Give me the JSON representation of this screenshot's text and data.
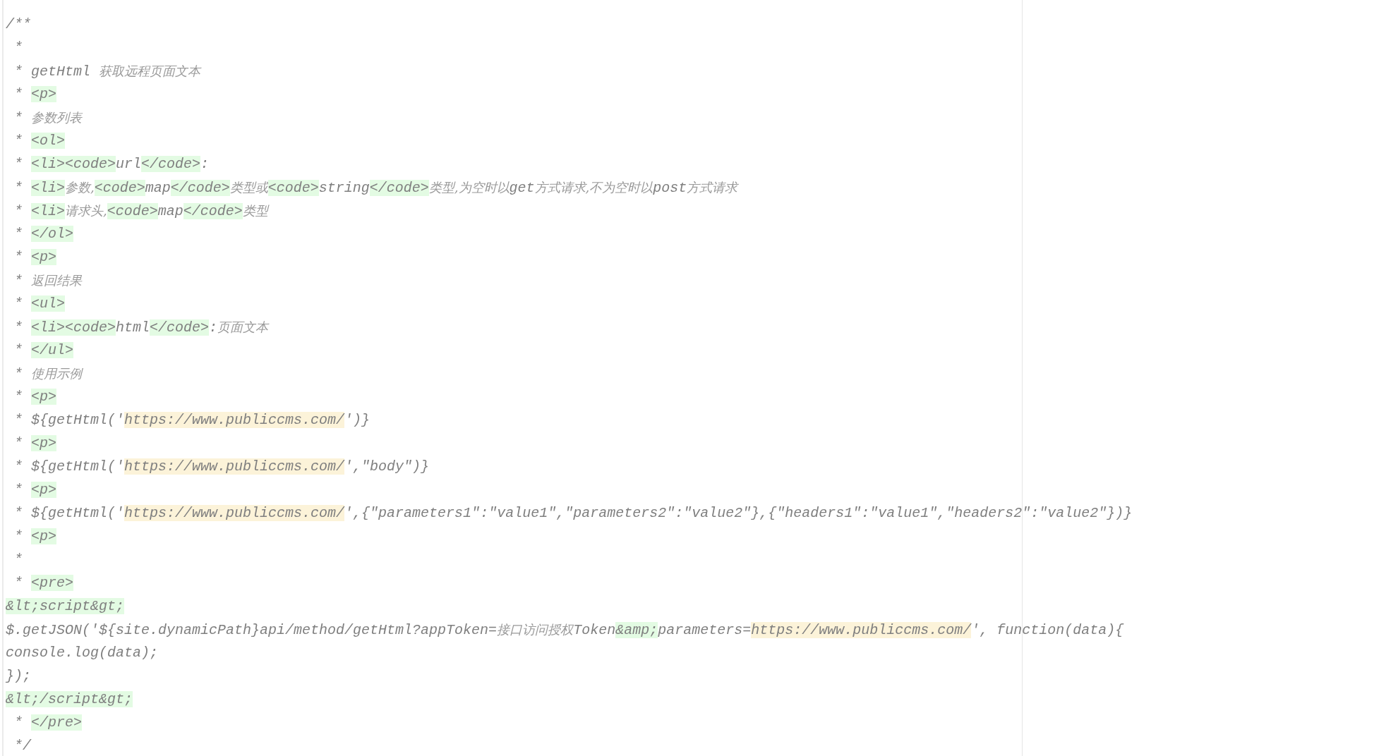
{
  "editor": {
    "lines": [
      [
        {
          "kind": "text",
          "text": "/**"
        }
      ],
      [
        {
          "kind": "text",
          "text": " *"
        }
      ],
      [
        {
          "kind": "text",
          "text": " * getHtml "
        },
        {
          "kind": "note",
          "text": "获取远程页面文本"
        }
      ],
      [
        {
          "kind": "text",
          "text": " * "
        },
        {
          "kind": "tag",
          "text": "<p>"
        }
      ],
      [
        {
          "kind": "text",
          "text": " * "
        },
        {
          "kind": "note",
          "text": "参数列表"
        }
      ],
      [
        {
          "kind": "text",
          "text": " * "
        },
        {
          "kind": "tag",
          "text": "<ol>"
        }
      ],
      [
        {
          "kind": "text",
          "text": " * "
        },
        {
          "kind": "tag",
          "text": "<li><code>"
        },
        {
          "kind": "text",
          "text": "url"
        },
        {
          "kind": "tag",
          "text": "</code>"
        },
        {
          "kind": "text",
          "text": ":"
        }
      ],
      [
        {
          "kind": "text",
          "text": " * "
        },
        {
          "kind": "tag",
          "text": "<li>"
        },
        {
          "kind": "note",
          "text": "参数,"
        },
        {
          "kind": "tag",
          "text": "<code>"
        },
        {
          "kind": "text",
          "text": "map"
        },
        {
          "kind": "tag",
          "text": "</code>"
        },
        {
          "kind": "note",
          "text": "类型或"
        },
        {
          "kind": "tag",
          "text": "<code>"
        },
        {
          "kind": "text",
          "text": "string"
        },
        {
          "kind": "tag",
          "text": "</code>"
        },
        {
          "kind": "note",
          "text": "类型,为空时以"
        },
        {
          "kind": "text",
          "text": "get"
        },
        {
          "kind": "note",
          "text": "方式请求,不为空时以"
        },
        {
          "kind": "text",
          "text": "post"
        },
        {
          "kind": "note",
          "text": "方式请求"
        }
      ],
      [
        {
          "kind": "text",
          "text": " * "
        },
        {
          "kind": "tag",
          "text": "<li>"
        },
        {
          "kind": "note",
          "text": "请求头,"
        },
        {
          "kind": "tag",
          "text": "<code>"
        },
        {
          "kind": "text",
          "text": "map"
        },
        {
          "kind": "tag",
          "text": "</code>"
        },
        {
          "kind": "note",
          "text": "类型"
        }
      ],
      [
        {
          "kind": "text",
          "text": " * "
        },
        {
          "kind": "tag",
          "text": "</ol>"
        }
      ],
      [
        {
          "kind": "text",
          "text": " * "
        },
        {
          "kind": "tag",
          "text": "<p>"
        }
      ],
      [
        {
          "kind": "text",
          "text": " * "
        },
        {
          "kind": "note",
          "text": "返回结果"
        }
      ],
      [
        {
          "kind": "text",
          "text": " * "
        },
        {
          "kind": "tag",
          "text": "<ul>"
        }
      ],
      [
        {
          "kind": "text",
          "text": " * "
        },
        {
          "kind": "tag",
          "text": "<li><code>"
        },
        {
          "kind": "text",
          "text": "html"
        },
        {
          "kind": "tag",
          "text": "</code>"
        },
        {
          "kind": "text",
          "text": ":"
        },
        {
          "kind": "note",
          "text": "页面文本"
        }
      ],
      [
        {
          "kind": "text",
          "text": " * "
        },
        {
          "kind": "tag",
          "text": "</ul>"
        }
      ],
      [
        {
          "kind": "text",
          "text": " * "
        },
        {
          "kind": "note",
          "text": "使用示例"
        }
      ],
      [
        {
          "kind": "text",
          "text": " * "
        },
        {
          "kind": "tag",
          "text": "<p>"
        }
      ],
      [
        {
          "kind": "text",
          "text": " * ${getHtml('"
        },
        {
          "kind": "url",
          "text": "https://www.publiccms.com/"
        },
        {
          "kind": "text",
          "text": "')}"
        }
      ],
      [
        {
          "kind": "text",
          "text": " * "
        },
        {
          "kind": "tag",
          "text": "<p>"
        }
      ],
      [
        {
          "kind": "text",
          "text": " * ${getHtml('"
        },
        {
          "kind": "url",
          "text": "https://www.publiccms.com/"
        },
        {
          "kind": "text",
          "text": "',\"body\")}"
        }
      ],
      [
        {
          "kind": "text",
          "text": " * "
        },
        {
          "kind": "tag",
          "text": "<p>"
        }
      ],
      [
        {
          "kind": "text",
          "text": " * ${getHtml('"
        },
        {
          "kind": "url",
          "text": "https://www.publiccms.com/"
        },
        {
          "kind": "text",
          "text": "',{\"parameters1\":\"value1\",\"parameters2\":\"value2\"},{\"headers1\":\"value1\",\"headers2\":\"value2\"})}"
        }
      ],
      [
        {
          "kind": "text",
          "text": " * "
        },
        {
          "kind": "tag",
          "text": "<p>"
        }
      ],
      [
        {
          "kind": "text",
          "text": " *"
        }
      ],
      [
        {
          "kind": "text",
          "text": " * "
        },
        {
          "kind": "tag",
          "text": "<pre>"
        }
      ],
      [
        {
          "kind": "tag",
          "text": "&lt;script&gt;"
        }
      ],
      [
        {
          "kind": "text",
          "text": "$.getJSON('${site.dynamicPath}api/method/getHtml?appToken="
        },
        {
          "kind": "note",
          "text": "接口访问授权"
        },
        {
          "kind": "text",
          "text": "Token"
        },
        {
          "kind": "tag",
          "text": "&amp;"
        },
        {
          "kind": "text",
          "text": "parameters="
        },
        {
          "kind": "url",
          "text": "https://www.publiccms.com/"
        },
        {
          "kind": "text",
          "text": "', function(data){"
        }
      ],
      [
        {
          "kind": "text",
          "text": "console.log(data);"
        }
      ],
      [
        {
          "kind": "text",
          "text": "});"
        }
      ],
      [
        {
          "kind": "tag",
          "text": "&lt;/script&gt;"
        }
      ],
      [
        {
          "kind": "text",
          "text": " * "
        },
        {
          "kind": "tag",
          "text": "</pre>"
        }
      ],
      [
        {
          "kind": "text",
          "text": " */"
        }
      ]
    ]
  }
}
